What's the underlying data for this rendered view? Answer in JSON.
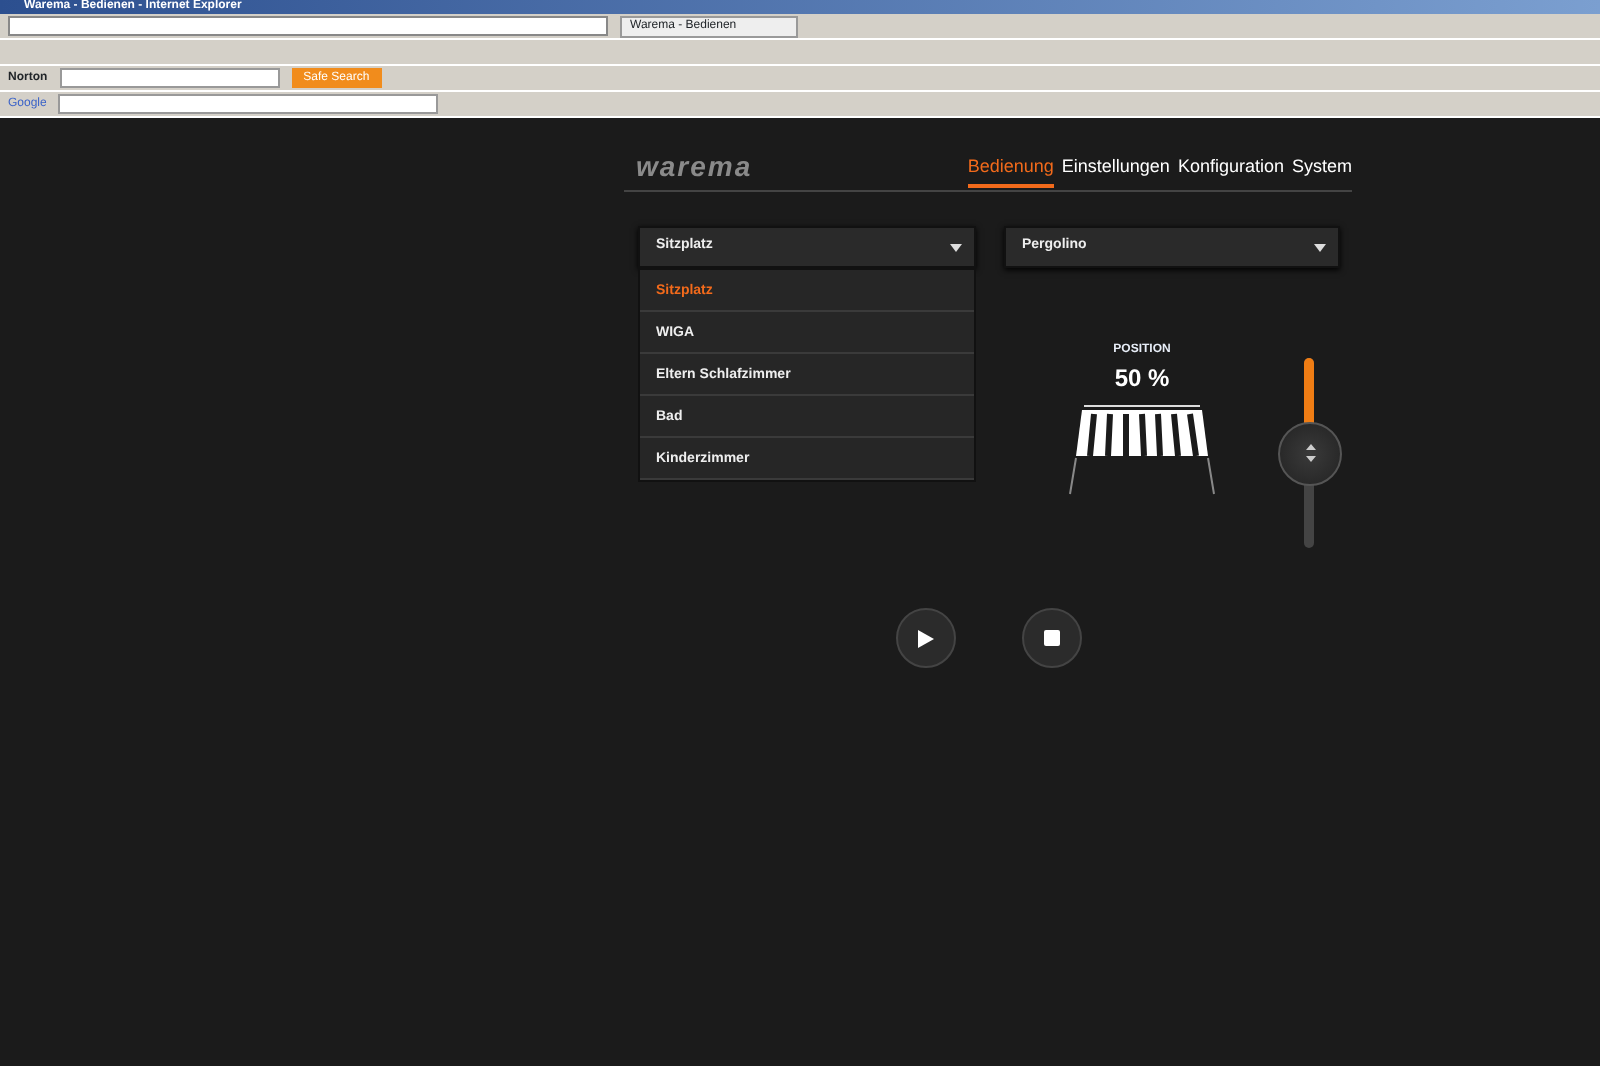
{
  "browser": {
    "title": "Warema - Bedienen - Internet Explorer",
    "tab": "Warema - Bedienen",
    "norton": "Norton",
    "safe_search": "Safe Search",
    "google": "Google"
  },
  "logo": "warema",
  "nav": [
    {
      "label": "Bedienung",
      "selected": true
    },
    {
      "label": "Einstellungen",
      "selected": false
    },
    {
      "label": "Konfiguration",
      "selected": false
    },
    {
      "label": "System",
      "selected": false
    }
  ],
  "room_select": {
    "value": "Sitzplatz",
    "expanded": true,
    "options": [
      {
        "label": "Sitzplatz",
        "selected": true
      },
      {
        "label": "WIGA",
        "selected": false
      },
      {
        "label": "Eltern Schlafzimmer",
        "selected": false
      },
      {
        "label": "Bad",
        "selected": false
      },
      {
        "label": "Kinderzimmer",
        "selected": false
      }
    ]
  },
  "device_select": {
    "value": "Pergolino"
  },
  "position": {
    "label": "POSITION",
    "reading": "50 %",
    "level": 0.5
  }
}
